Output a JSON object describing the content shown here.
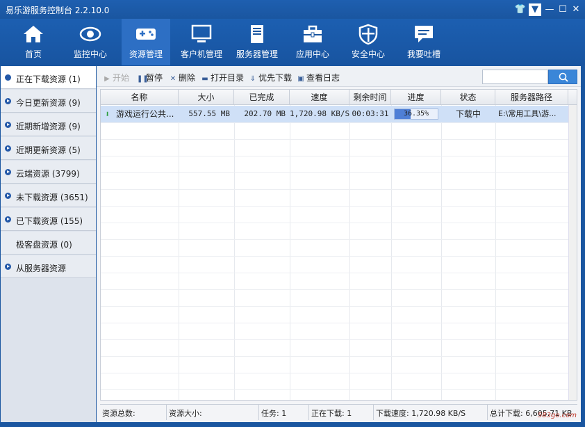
{
  "window": {
    "title": "易乐游服务控制台 2.2.10.0"
  },
  "nav": {
    "items": [
      {
        "label": "首页",
        "icon": "home-icon"
      },
      {
        "label": "监控中心",
        "icon": "eye-icon"
      },
      {
        "label": "资源管理",
        "icon": "gamepad-icon"
      },
      {
        "label": "客户机管理",
        "icon": "monitor-icon"
      },
      {
        "label": "服务器管理",
        "icon": "server-icon"
      },
      {
        "label": "应用中心",
        "icon": "toolbox-icon"
      },
      {
        "label": "安全中心",
        "icon": "shield-icon"
      },
      {
        "label": "我要吐槽",
        "icon": "comment-icon"
      }
    ],
    "active_index": 2
  },
  "sidebar": {
    "items": [
      {
        "label": "正在下载资源 (1)"
      },
      {
        "label": "今日更新资源 (9)"
      },
      {
        "label": "近期新增资源 (9)"
      },
      {
        "label": "近期更新资源 (5)"
      },
      {
        "label": "云端资源 (3799)"
      },
      {
        "label": "未下载资源 (3651)"
      },
      {
        "label": "已下载资源 (155)"
      },
      {
        "label": "极客盘资源 (0)"
      },
      {
        "label": "从服务器资源"
      }
    ]
  },
  "toolbar": {
    "start": "开始",
    "pause": "暂停",
    "delete": "删除",
    "open_dir": "打开目录",
    "priority": "优先下载",
    "view_log": "查看日志",
    "search_placeholder": ""
  },
  "table": {
    "headers": [
      "名称",
      "大小",
      "已完成",
      "速度",
      "剩余时间",
      "进度",
      "状态",
      "服务器路径"
    ],
    "rows": [
      {
        "name": "游戏运行公共...",
        "size": "557.55 MB",
        "done": "202.70 MB",
        "speed": "1,720.98 KB/S",
        "remaining": "00:03:31",
        "progress_text": "36.35%",
        "progress": 0.3635,
        "status": "下载中",
        "path": "E:\\常用工具\\游..."
      }
    ]
  },
  "status": {
    "total": "资源总数:",
    "size": "资源大小:",
    "tasks": "任务: 1",
    "downloading": "正在下载: 1",
    "speed": "下载速度: 1,720.98 KB/S",
    "total_dl": "总计下载: 6,605.71 KB"
  },
  "watermark": "583go.com",
  "colors": {
    "accent": "#1a56a0",
    "nav_active": "#2d6fc4",
    "row_selected": "#cfe0f7",
    "progress_fill": "#4f7fd6"
  }
}
